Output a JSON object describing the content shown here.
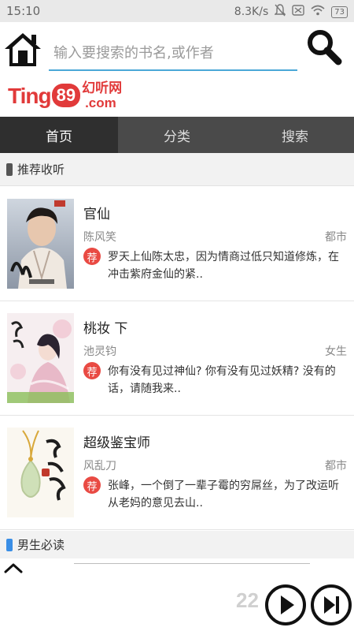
{
  "status_bar": {
    "time": "15:10",
    "network_speed": "8.3K/s",
    "battery": "73"
  },
  "header": {
    "search": {
      "placeholder": "输入要搜索的书名,或作者"
    },
    "logo": {
      "ting": "Ting",
      "num": "89",
      "cn": "幻听网",
      "com": ".com"
    }
  },
  "tabs": [
    {
      "label": "首页",
      "active": true
    },
    {
      "label": "分类",
      "active": false
    },
    {
      "label": "搜索",
      "active": false
    }
  ],
  "sections": {
    "recommended": {
      "title": "推荐收听",
      "color": "#555555"
    },
    "male": {
      "title": "男生必读",
      "color": "#3a8ee6"
    }
  },
  "rec_badge": "荐",
  "books": [
    {
      "title": "官仙",
      "author": "陈风笑",
      "category": "都市",
      "desc": "罗天上仙陈太忠，因为情商过低只知道修炼，在冲击紫府金仙的紧.."
    },
    {
      "title": "桃妆 下",
      "author": "池灵钧",
      "category": "女生",
      "desc": "你有没有见过神仙? 你有没有见过妖精? 没有的话，请随我来.."
    },
    {
      "title": "超级鉴宝师",
      "author": "风乱刀",
      "category": "都市",
      "desc": "张峰，一个倒了一辈子霉的穷屌丝，为了改运听从老妈的意见去山.."
    }
  ],
  "player": {
    "watermark": "22"
  },
  "colors": {
    "accent": "#4aa8d8",
    "tab_bg": "#4a4a4a",
    "tab_active": "#2f2f2f",
    "badge": "#e94a43",
    "logo_red": "#e13a3a"
  }
}
